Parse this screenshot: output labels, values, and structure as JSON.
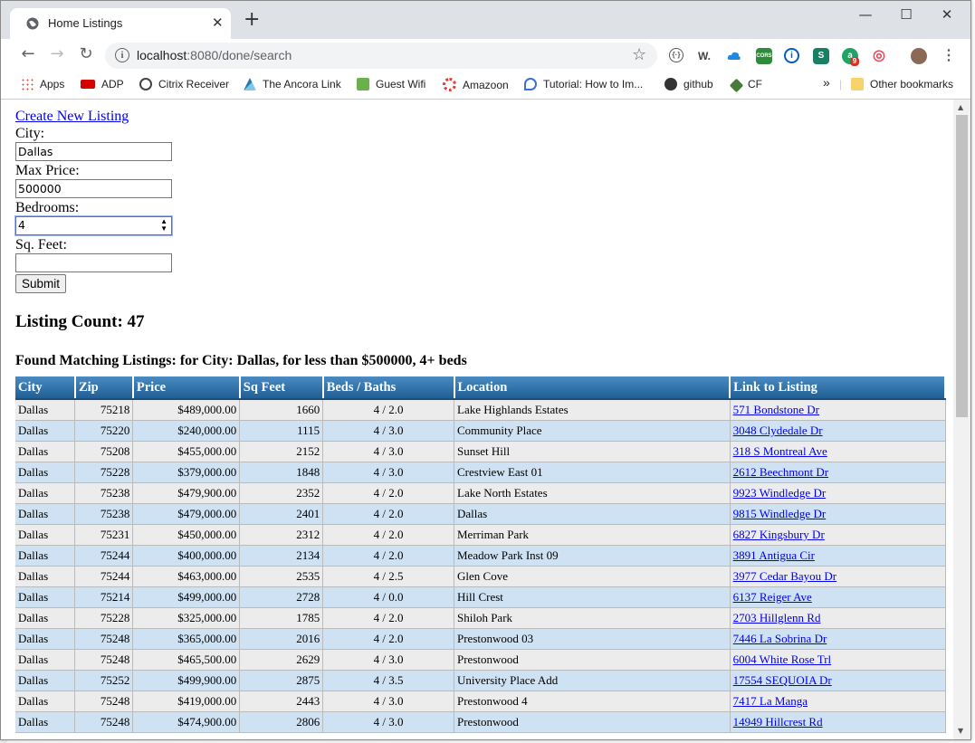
{
  "browser": {
    "tab_title": "Home Listings",
    "tab_close": "✕",
    "new_tab": "+",
    "url_host": "localhost",
    "url_path": ":8080/done/search",
    "window_controls": {
      "minimize": "—",
      "maximize": "☐",
      "close": "✕"
    },
    "extensions": [
      {
        "label": "W.",
        "color": "#444444"
      },
      {
        "label": "CORS",
        "color": "#2e8b3a"
      },
      {
        "label": "S",
        "color": "#1a7f64"
      },
      {
        "label": "9",
        "color": "#d93025"
      }
    ],
    "bookmarks": [
      {
        "label": "Apps",
        "color": "#ea4335"
      },
      {
        "label": "ADP",
        "color": "#d40000"
      },
      {
        "label": "Citrix Receiver",
        "color": "#444444"
      },
      {
        "label": "The Ancora Link",
        "color": "#2a7ab0"
      },
      {
        "label": "Guest Wifi",
        "color": "#6ab04c"
      },
      {
        "label": "Amazoon",
        "color": "#e03c31"
      },
      {
        "label": "Tutorial: How to Im...",
        "color": "#3c6fd8"
      },
      {
        "label": "github",
        "color": "#333333"
      },
      {
        "label": "CF",
        "color": "#4a7a3a"
      }
    ],
    "bookmarks_overflow": "»",
    "other_bookmarks": "Other bookmarks"
  },
  "page": {
    "create_link": "Create New Listing",
    "form": {
      "city_label": "City:",
      "city_value": "Dallas",
      "max_price_label": "Max Price:",
      "max_price_value": "500000",
      "bedrooms_label": "Bedrooms:",
      "bedrooms_value": "4",
      "sqft_label": "Sq. Feet:",
      "sqft_value": "",
      "submit_label": "Submit"
    },
    "listing_count": "Listing Count: 47",
    "found_heading": "Found Matching Listings: for City: Dallas, for less than $500000, 4+ beds"
  },
  "table": {
    "headers": [
      "City",
      "Zip",
      "Price",
      "Sq Feet",
      "Beds / Baths",
      "Location",
      "Link to Listing"
    ],
    "rows": [
      [
        "Dallas",
        "75218",
        "$489,000.00",
        "1660",
        "4 / 2.0",
        "Lake Highlands Estates",
        "571 Bondstone Dr"
      ],
      [
        "Dallas",
        "75220",
        "$240,000.00",
        "1115",
        "4 / 3.0",
        "Community Place",
        "3048 Clydedale Dr"
      ],
      [
        "Dallas",
        "75208",
        "$455,000.00",
        "2152",
        "4 / 3.0",
        "Sunset Hill",
        "318 S Montreal Ave"
      ],
      [
        "Dallas",
        "75228",
        "$379,000.00",
        "1848",
        "4 / 3.0",
        "Crestview East 01",
        "2612 Beechmont Dr"
      ],
      [
        "Dallas",
        "75238",
        "$479,900.00",
        "2352",
        "4 / 2.0",
        "Lake North Estates",
        "9923 Windledge Dr"
      ],
      [
        "Dallas",
        "75238",
        "$479,000.00",
        "2401",
        "4 / 2.0",
        "Dallas",
        "9815 Windledge Dr"
      ],
      [
        "Dallas",
        "75231",
        "$450,000.00",
        "2312",
        "4 / 2.0",
        "Merriman Park",
        "6827 Kingsbury Dr"
      ],
      [
        "Dallas",
        "75244",
        "$400,000.00",
        "2134",
        "4 / 2.0",
        "Meadow Park Inst 09",
        "3891 Antigua Cir"
      ],
      [
        "Dallas",
        "75244",
        "$463,000.00",
        "2535",
        "4 / 2.5",
        "Glen Cove",
        "3977 Cedar Bayou Dr"
      ],
      [
        "Dallas",
        "75214",
        "$499,000.00",
        "2728",
        "4 / 0.0",
        "Hill Crest",
        "6137 Reiger Ave"
      ],
      [
        "Dallas",
        "75228",
        "$325,000.00",
        "1785",
        "4 / 2.0",
        "Shiloh Park",
        "2703 Hillglenn Rd"
      ],
      [
        "Dallas",
        "75248",
        "$365,000.00",
        "2016",
        "4 / 2.0",
        "Prestonwood 03",
        "7446 La Sobrina Dr"
      ],
      [
        "Dallas",
        "75248",
        "$465,500.00",
        "2629",
        "4 / 3.0",
        "Prestonwood",
        "6004 White Rose Trl"
      ],
      [
        "Dallas",
        "75252",
        "$499,900.00",
        "2875",
        "4 / 3.5",
        "University Place Add",
        "17554 SEQUOIA Dr"
      ],
      [
        "Dallas",
        "75248",
        "$419,000.00",
        "2443",
        "4 / 3.0",
        "Prestonwood 4",
        "7417 La Manga"
      ],
      [
        "Dallas",
        "75248",
        "$474,900.00",
        "2806",
        "4 / 3.0",
        "Prestonwood",
        "14949 Hillcrest Rd"
      ]
    ]
  }
}
